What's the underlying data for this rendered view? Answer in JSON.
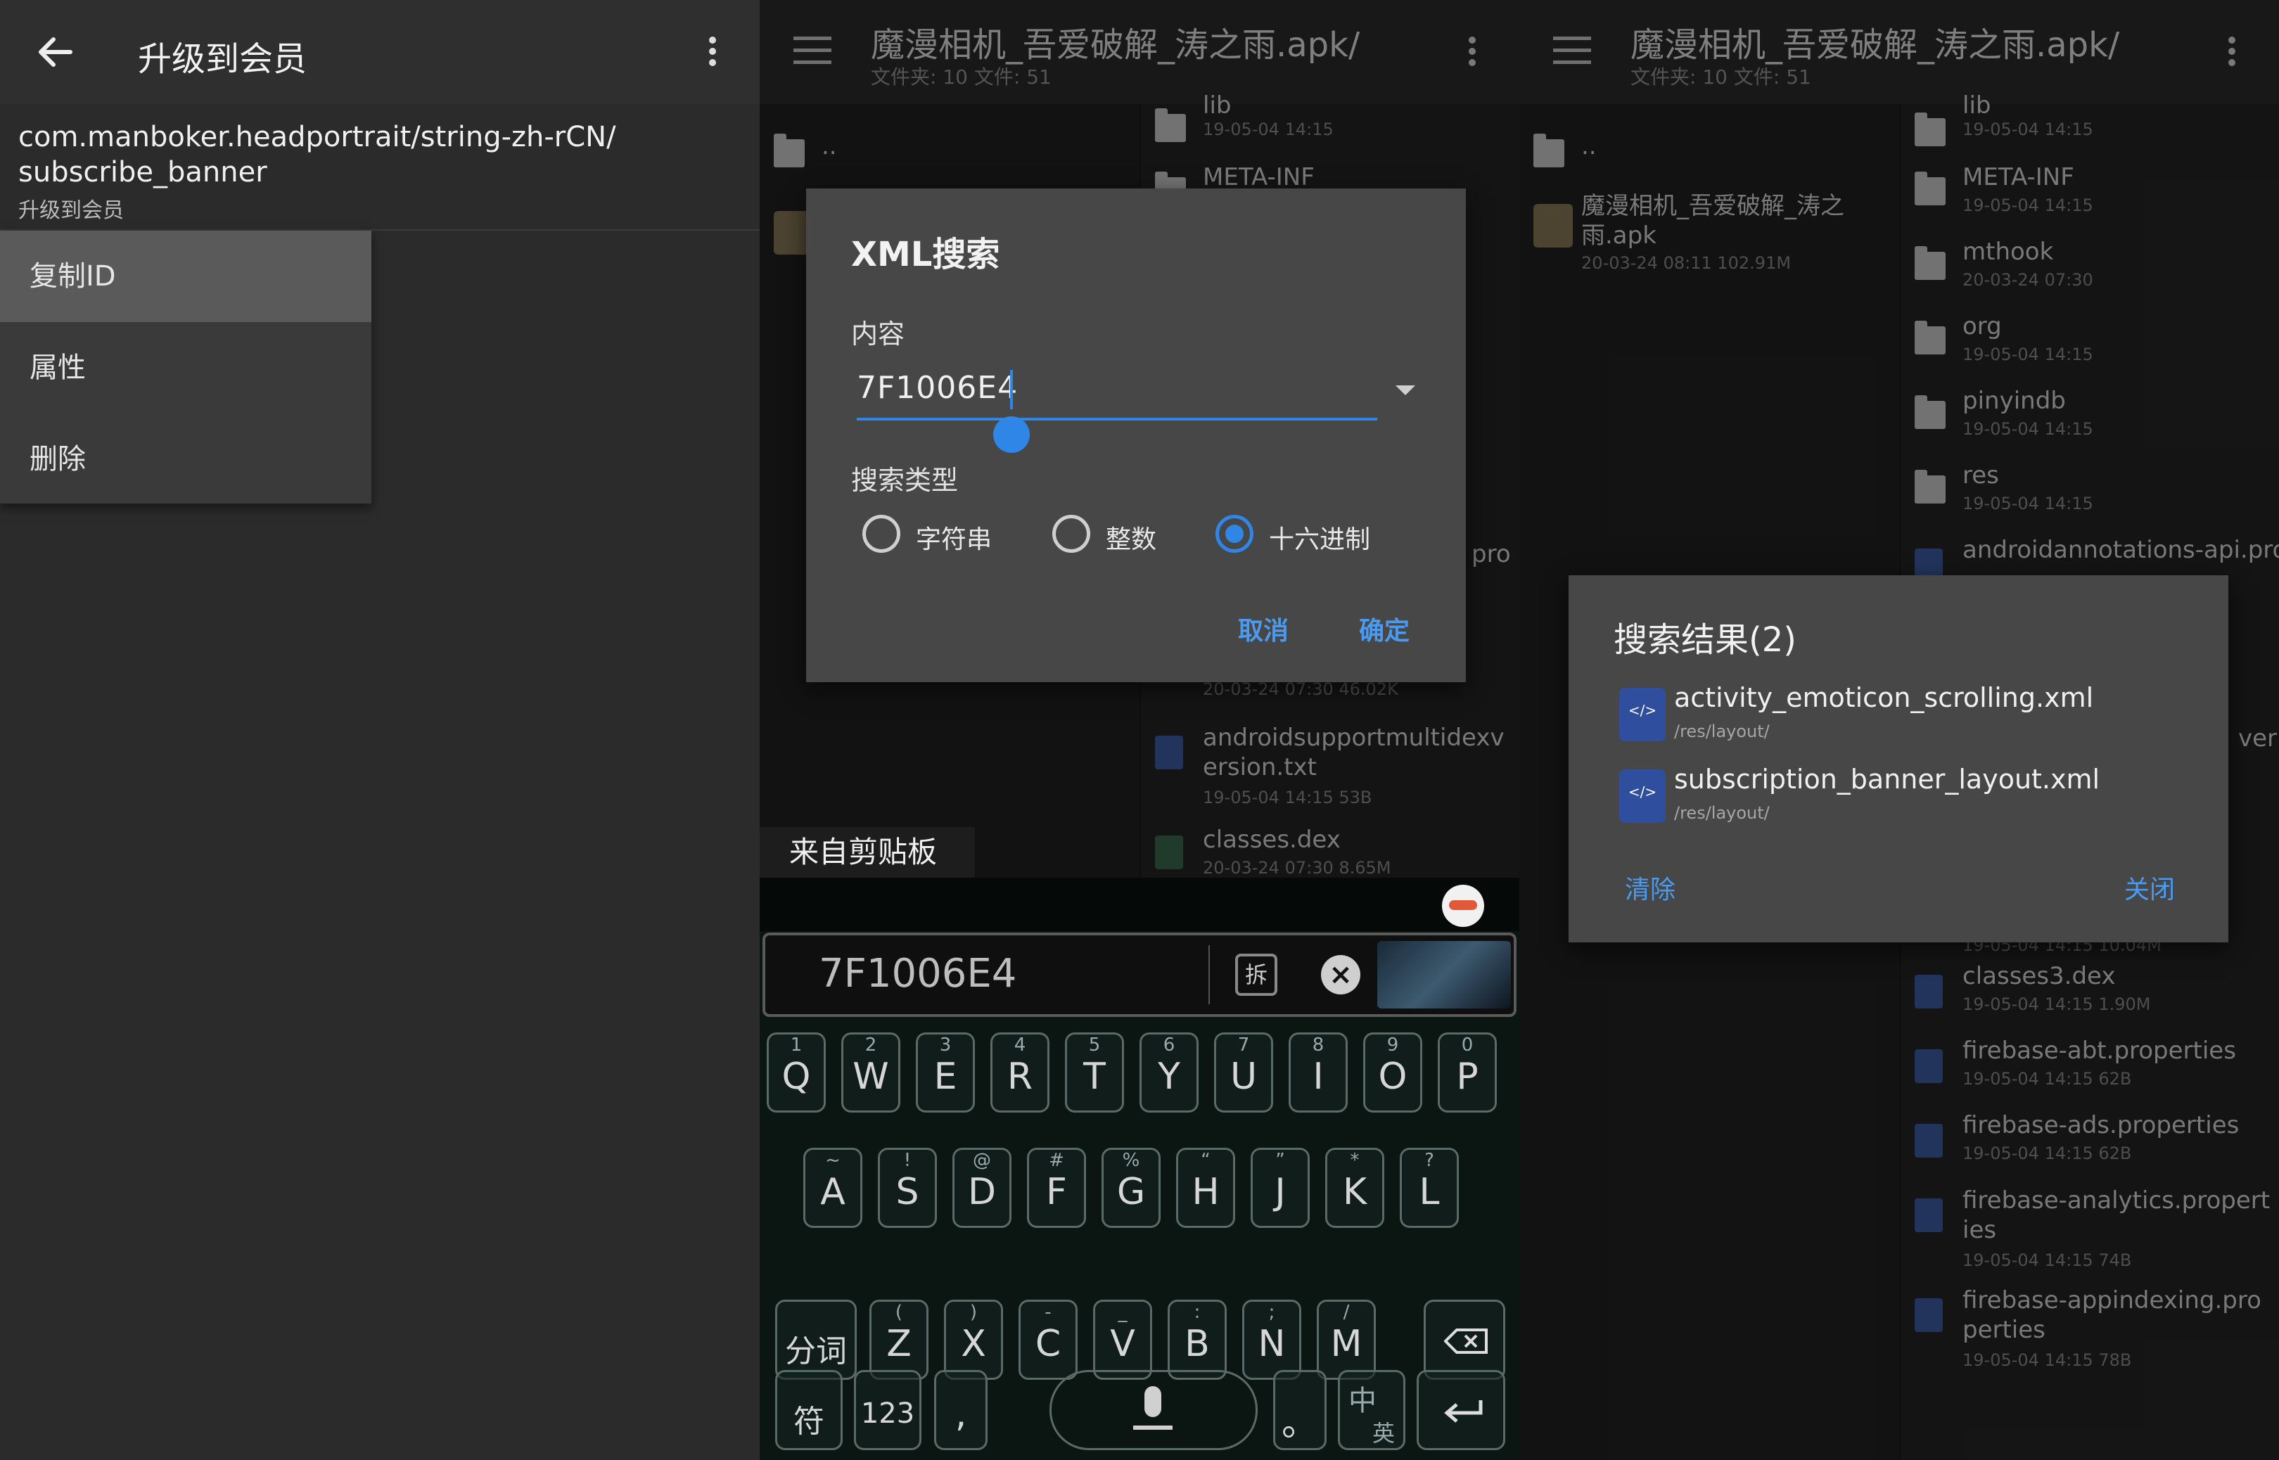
{
  "p1": {
    "title": "升级到会员",
    "path": [
      "com.manboker.headportrait/string-zh-rCN/",
      "subscribe_banner"
    ],
    "subtitle": "升级到会员",
    "menu": [
      "复制ID",
      "属性",
      "删除"
    ]
  },
  "p2": {
    "title": "魔漫相机_吾爱破解_涛之雨.apk/",
    "counts": "文件夹: 10  文件: 51",
    "left_items": [
      {
        "name": "..",
        "meta": ""
      },
      {
        "name": "",
        "meta": ""
      }
    ],
    "right_items": [
      {
        "name": "lib",
        "meta": "19-05-04 14:15"
      },
      {
        "name": "META-INF",
        "meta": ""
      },
      {
        "name": "pro",
        "meta": ""
      },
      {
        "name": "",
        "meta": "20-03-24 07:30  46.02K"
      },
      {
        "name": "androidsupportmultidexversion.txt",
        "meta": "19-05-04 14:15  53B"
      },
      {
        "name": "classes.dex",
        "meta": "20-03-24 07:30  8.65M"
      }
    ],
    "dialog": {
      "title": "XML搜索",
      "content_label": "内容",
      "input_value": "7F1006E4",
      "type_label": "搜索类型",
      "options": [
        "字符串",
        "整数",
        "十六进制"
      ],
      "selected": 2,
      "cancel": "取消",
      "ok": "确定"
    },
    "clipboard_tab": "来自剪贴板",
    "candidate": "7F1006E4",
    "split_icon": "拆",
    "keys_row1": [
      {
        "k": "Q",
        "s": "1"
      },
      {
        "k": "W",
        "s": "2"
      },
      {
        "k": "E",
        "s": "3"
      },
      {
        "k": "R",
        "s": "4"
      },
      {
        "k": "T",
        "s": "5"
      },
      {
        "k": "Y",
        "s": "6"
      },
      {
        "k": "U",
        "s": "7"
      },
      {
        "k": "I",
        "s": "8"
      },
      {
        "k": "O",
        "s": "9"
      },
      {
        "k": "P",
        "s": "0"
      }
    ],
    "keys_row2": [
      {
        "k": "A",
        "s": "~"
      },
      {
        "k": "S",
        "s": "!"
      },
      {
        "k": "D",
        "s": "@"
      },
      {
        "k": "F",
        "s": "#"
      },
      {
        "k": "G",
        "s": "%"
      },
      {
        "k": "H",
        "s": "“"
      },
      {
        "k": "J",
        "s": "”"
      },
      {
        "k": "K",
        "s": "*"
      },
      {
        "k": "L",
        "s": "?"
      }
    ],
    "keys_row3": [
      {
        "k": "Z",
        "s": "("
      },
      {
        "k": "X",
        "s": ")"
      },
      {
        "k": "C",
        "s": "-"
      },
      {
        "k": "V",
        "s": "_"
      },
      {
        "k": "B",
        "s": ":"
      },
      {
        "k": "N",
        "s": ";"
      },
      {
        "k": "M",
        "s": "/"
      }
    ],
    "key_fenci": "分词",
    "key_fu": "符",
    "key_123": "123",
    "key_comma": ",",
    "key_period": "。",
    "key_zhong": "中",
    "key_ying": "英"
  },
  "p3": {
    "title": "魔漫相机_吾爱破解_涛之雨.apk/",
    "counts": "文件夹: 10  文件: 51",
    "left_items": [
      {
        "name": "..",
        "meta": ""
      },
      {
        "name": "魔漫相机_吾爱破解_涛之雨.apk",
        "meta": "20-03-24 08:11  102.91M"
      }
    ],
    "right_items": [
      {
        "name": "lib",
        "meta": "19-05-04 14:15"
      },
      {
        "name": "META-INF",
        "meta": "19-05-04 14:15"
      },
      {
        "name": "mthook",
        "meta": "20-03-24 07:30"
      },
      {
        "name": "org",
        "meta": "19-05-04 14:15"
      },
      {
        "name": "pinyindb",
        "meta": "19-05-04 14:15"
      },
      {
        "name": "res",
        "meta": "19-05-04 14:15"
      },
      {
        "name": "androidannotations-api.pro",
        "meta": ""
      },
      {
        "name": "classes3.dex",
        "meta": "19-05-04 14:15  1.90M"
      },
      {
        "name": "firebase-abt.properties",
        "meta": "19-05-04 14:15  62B"
      },
      {
        "name": "firebase-ads.properties",
        "meta": "19-05-04 14:15  62B"
      },
      {
        "name": "firebase-analytics.properties",
        "meta": "19-05-04 14:15  74B"
      },
      {
        "name": "firebase-appindexing.properties",
        "meta": "19-05-04 14:15  78B"
      }
    ],
    "partial_meta": "19-05-04 14:15  10.04M",
    "partial_ver": "ver",
    "results": {
      "title": "搜索结果(2)",
      "items": [
        {
          "name": "activity_emoticon_scrolling.xml",
          "path": "/res/layout/"
        },
        {
          "name": "subscription_banner_layout.xml",
          "path": "/res/layout/"
        }
      ],
      "clear": "清除",
      "close": "关闭"
    }
  },
  "colors": {
    "accent": "#2f86e6",
    "dialog_bg": "#474747",
    "file_icon": "#3f5fa8"
  }
}
